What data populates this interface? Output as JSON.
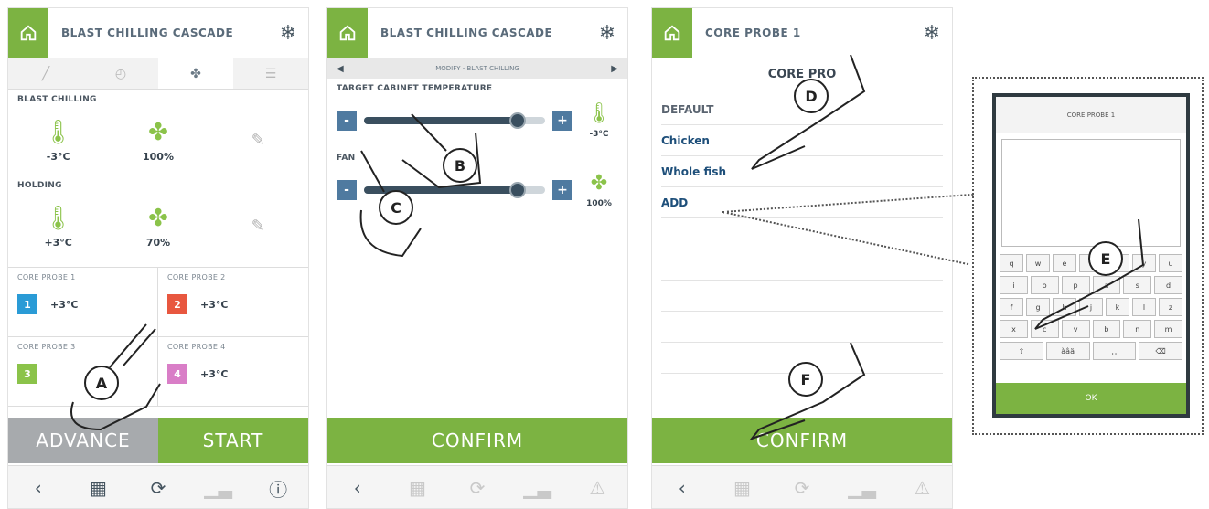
{
  "screen1": {
    "header_title": "BLAST CHILLING CASCADE",
    "blast": {
      "label": "BLAST CHILLING",
      "temp": "-3°C",
      "fan": "100%"
    },
    "holding": {
      "label": "HOLDING",
      "temp": "+3°C",
      "fan": "70%"
    },
    "probes": [
      {
        "label": "CORE PROBE 1",
        "num": "1",
        "temp": "+3°C",
        "color": "#2a9bd6"
      },
      {
        "label": "CORE PROBE 2",
        "num": "2",
        "temp": "+3°C",
        "color": "#e8573f"
      },
      {
        "label": "CORE PROBE 3",
        "num": "3",
        "temp": "",
        "color": "#8bc34a"
      },
      {
        "label": "CORE PROBE 4",
        "num": "4",
        "temp": "+3°C",
        "color": "#d97ec7"
      }
    ],
    "btn_left": "ADVANCE",
    "btn_right": "START"
  },
  "screen2": {
    "header_title": "BLAST CHILLING CASCADE",
    "subnav": "MODIFY - BLAST CHILLING",
    "target_label": "TARGET CABINET TEMPERATURE",
    "target_value": "-3°C",
    "target_fraction": 0.85,
    "fan_label": "FAN",
    "fan_value": "100%",
    "fan_fraction": 0.85,
    "btn": "CONFIRM"
  },
  "screen3": {
    "header_title": "CORE PROBE 1",
    "list_title": "CORE PRO",
    "items": [
      "DEFAULT",
      "Chicken",
      "Whole fish",
      "ADD"
    ],
    "btn": "CONFIRM"
  },
  "keyboard": {
    "title": "CORE PROBE 1",
    "rows": [
      [
        "q",
        "w",
        "e",
        "r",
        "t",
        "y",
        "u"
      ],
      [
        "i",
        "o",
        "p",
        "a",
        "s",
        "d"
      ],
      [
        "f",
        "g",
        "h",
        "j",
        "k",
        "l",
        "z"
      ],
      [
        "x",
        "c",
        "v",
        "b",
        "n",
        "m"
      ],
      [
        "⇧",
        "àâä",
        "␣",
        "⌫"
      ]
    ],
    "ok": "OK"
  },
  "callouts": [
    "A",
    "B",
    "C",
    "D",
    "E",
    "F"
  ],
  "colors": {
    "green": "#7cb342",
    "blue": "#4f7aa0",
    "grey": "#a7aaad"
  }
}
